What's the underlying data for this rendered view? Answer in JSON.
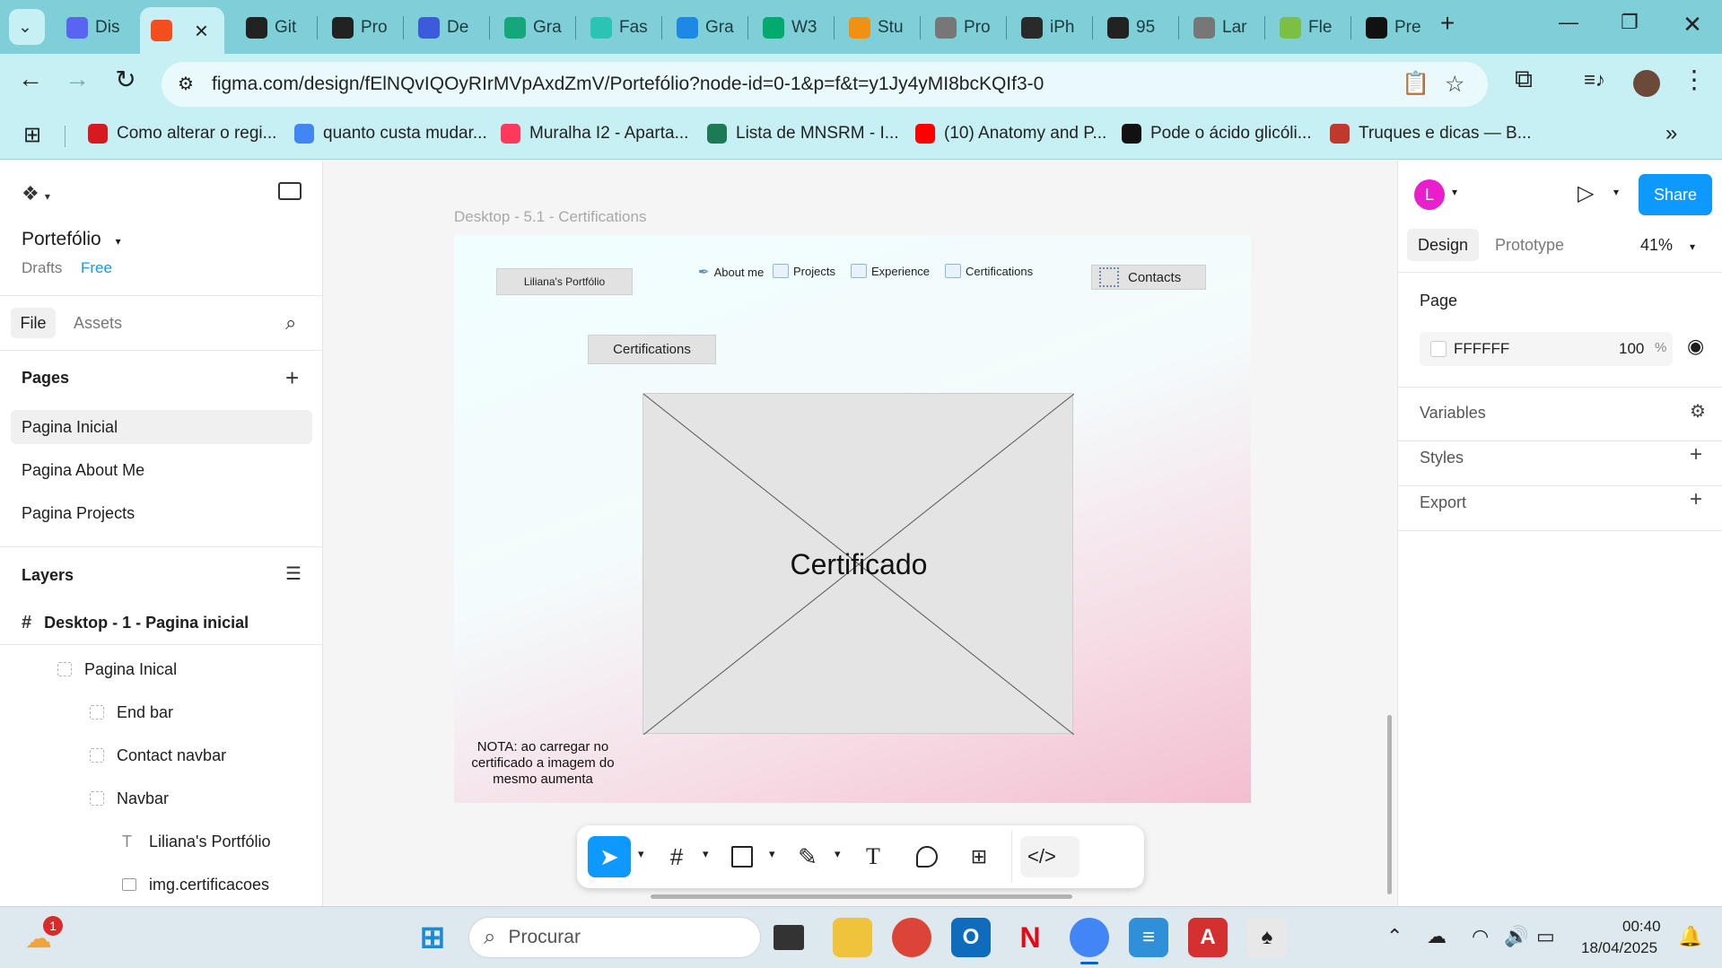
{
  "browser": {
    "tabs": [
      {
        "label": "Dis",
        "icon": "discord-icon",
        "color": "#5865f2"
      },
      {
        "label": "",
        "icon": "figma-icon",
        "color": "#f24e1e",
        "active": true
      },
      {
        "label": "Git",
        "icon": "github-icon",
        "color": "#222222"
      },
      {
        "label": "Pro",
        "icon": "openai-icon",
        "color": "#222222"
      },
      {
        "label": "De",
        "icon": "forms-icon",
        "color": "#3b5bdb"
      },
      {
        "label": "Gra",
        "icon": "grammarly-icon",
        "color": "#15a77b"
      },
      {
        "label": "Fas",
        "icon": "vuetify-icon",
        "color": "#2bc3b4"
      },
      {
        "label": "Gra",
        "icon": "gradescope-icon",
        "color": "#1e88e5"
      },
      {
        "label": "W3",
        "icon": "w3schools-icon",
        "color": "#04aa6d"
      },
      {
        "label": "Stu",
        "icon": "mysql-icon",
        "color": "#f29111"
      },
      {
        "label": "Pro",
        "icon": "globe-icon",
        "color": "#777777"
      },
      {
        "label": "iPh",
        "icon": "s-icon",
        "color": "#2a2a2a"
      },
      {
        "label": "95",
        "icon": "cursor-icon",
        "color": "#222222"
      },
      {
        "label": "Lar",
        "icon": "globe-icon",
        "color": "#777777"
      },
      {
        "label": "Fle",
        "icon": "frog-icon",
        "color": "#7bc043"
      },
      {
        "label": "Pre",
        "icon": "circle-icon",
        "color": "#111111"
      }
    ],
    "url": "figma.com/design/fElNQvIQOyRIrMVpAxdZmV/Portefólio?node-id=0-1&p=f&t=y1Jy4yMI8bcKQIf3-0",
    "bookmarks": [
      {
        "label": "Como alterar o regi...",
        "icon": "acp-icon",
        "color": "#d71920"
      },
      {
        "label": "quanto custa mudar...",
        "icon": "google-icon",
        "color": "#4285f4"
      },
      {
        "label": "Muralha I2 - Aparta...",
        "icon": "airbnb-icon",
        "color": "#ff385c"
      },
      {
        "label": "Lista de MNSRM - I...",
        "icon": "infarmed-icon",
        "color": "#1c7a55"
      },
      {
        "label": "(10) Anatomy and P...",
        "icon": "youtube-icon",
        "color": "#ff0000"
      },
      {
        "label": "Pode o ácido glicóli...",
        "icon": "wp-icon",
        "color": "#111111"
      },
      {
        "label": "Truques e dicas — B...",
        "icon": "bf-icon",
        "color": "#c0392b"
      }
    ]
  },
  "figma": {
    "file_name": "Portefólio",
    "drafts_label": "Drafts",
    "plan_label": "Free",
    "tab_file": "File",
    "tab_assets": "Assets",
    "pages_heading": "Pages",
    "pages": [
      "Pagina Inicial",
      "Pagina About Me",
      "Pagina Projects"
    ],
    "layers_heading": "Layers",
    "layers": [
      {
        "label": "Desktop - 1 - Pagina inicial",
        "type": "frame",
        "depth": 0
      },
      {
        "label": "Pagina Inical",
        "type": "group",
        "depth": 1
      },
      {
        "label": "End bar",
        "type": "group",
        "depth": 2
      },
      {
        "label": "Contact navbar",
        "type": "group",
        "depth": 2
      },
      {
        "label": "Navbar",
        "type": "group",
        "depth": 2
      },
      {
        "label": "Liliana's Portfólio",
        "type": "text",
        "depth": 3
      },
      {
        "label": "img.certificacoes",
        "type": "image",
        "depth": 3
      }
    ],
    "canvas": {
      "frame_label": "Desktop - 5.1 - Certifications",
      "logo_button": "Liliana's Portfólio",
      "nav": [
        "About me",
        "Projects",
        "Experience",
        "Certifications"
      ],
      "contacts_button": "Contacts",
      "section_button": "Certifications",
      "image_label": "Certificado",
      "note": "NOTA: ao carregar no certificado a imagem do mesmo aumenta"
    },
    "right_panel": {
      "avatar_initial": "L",
      "share_label": "Share",
      "tab_design": "Design",
      "tab_prototype": "Prototype",
      "zoom": "41%",
      "page_heading": "Page",
      "page_color": "FFFFFF",
      "page_opacity": "100",
      "opacity_unit": "%",
      "variables": "Variables",
      "styles": "Styles",
      "export": "Export"
    },
    "accent": "#0d99ff"
  },
  "taskbar": {
    "search_placeholder": "Procurar",
    "time": "00:40",
    "date": "18/04/2025",
    "weather_badge": "1"
  }
}
